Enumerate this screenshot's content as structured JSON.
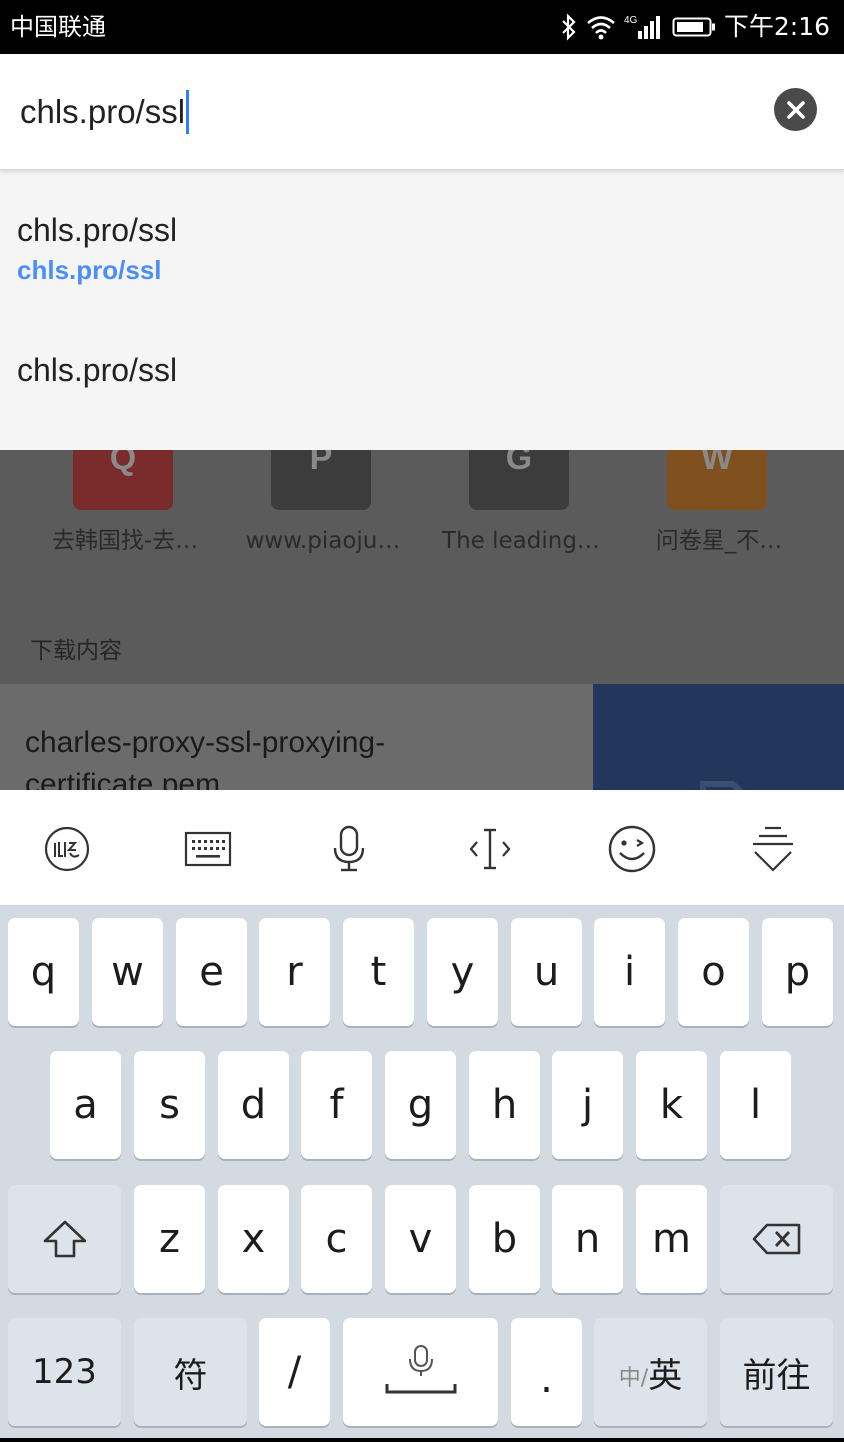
{
  "status_bar": {
    "carrier": "中国联通",
    "network_label": "4G",
    "time": "下午2:16",
    "icons": [
      "bluetooth-icon",
      "wifi-icon",
      "signal-icon",
      "battery-icon"
    ]
  },
  "url_bar": {
    "value": "chls.pro/ssl",
    "clear_icon": "close-circle-icon"
  },
  "suggestions": [
    {
      "title": "chls.pro/ssl",
      "url": "chls.pro/ssl"
    },
    {
      "title": "chls.pro/ssl"
    }
  ],
  "background_page": {
    "tiles": [
      {
        "letter": "Q",
        "label": "去韩国找-去…",
        "color": "#7a2b2b"
      },
      {
        "letter": "P",
        "label": "www.piaoju…",
        "color": "#3c3c3c"
      },
      {
        "letter": "G",
        "label": "The leading…",
        "color": "#3c3c3c"
      },
      {
        "letter": "W",
        "label": "问卷星_不…",
        "color": "#80501f"
      }
    ],
    "downloads_heading": "下载内容",
    "download_item": "charles-proxy-ssl-proxying-certificate.pem"
  },
  "keyboard": {
    "toolbar": [
      "xunfei-logo-icon",
      "keyboard-icon",
      "microphone-icon",
      "cursor-move-icon",
      "emoji-icon",
      "hide-keyboard-icon"
    ],
    "row1": [
      "q",
      "w",
      "e",
      "r",
      "t",
      "y",
      "u",
      "i",
      "o",
      "p"
    ],
    "row2": [
      "a",
      "s",
      "d",
      "f",
      "g",
      "h",
      "j",
      "k",
      "l"
    ],
    "row3": [
      "z",
      "x",
      "c",
      "v",
      "b",
      "n",
      "m"
    ],
    "numbers_key": "123",
    "symbols_key": "符",
    "slash_key": "/",
    "period_key": ".",
    "lang_key_small": "中/",
    "lang_key": "英",
    "go_key": "前往",
    "colors": {
      "keyboard_bg": "#d4dae2",
      "key_bg": "#ffffff",
      "accent": "#4b8ef7"
    }
  }
}
